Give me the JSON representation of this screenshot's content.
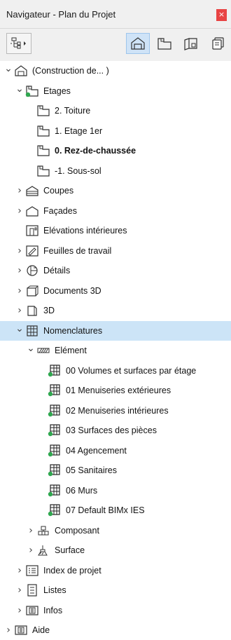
{
  "window": {
    "title": "Navigateur - Plan du Projet",
    "close_symbol": "×"
  },
  "toolbar": {
    "buttons": [
      {
        "icon": "navigator-menu-icon"
      },
      {
        "icon": "project-map-icon",
        "active": true
      },
      {
        "icon": "view-map-icon"
      },
      {
        "icon": "layout-book-icon"
      },
      {
        "icon": "publisher-sets-icon"
      }
    ]
  },
  "tree": [
    {
      "label": "(Construction de... )",
      "depth": 0,
      "expanded": true,
      "icon": "project-icon"
    },
    {
      "label": "Etages",
      "depth": 1,
      "expanded": true,
      "icon": "stories-icon",
      "dot": true
    },
    {
      "label": "2. Toiture",
      "depth": 2,
      "icon": "story-icon"
    },
    {
      "label": "1. Etage 1er",
      "depth": 2,
      "icon": "story-icon"
    },
    {
      "label": "0. Rez-de-chaussée",
      "depth": 2,
      "icon": "story-icon",
      "bold": true
    },
    {
      "label": "-1. Sous-sol",
      "depth": 2,
      "icon": "story-icon"
    },
    {
      "label": "Coupes",
      "depth": 1,
      "expanded": false,
      "icon": "sections-icon"
    },
    {
      "label": "Façades",
      "depth": 1,
      "expanded": false,
      "icon": "elevations-icon"
    },
    {
      "label": "Elévations intérieures",
      "depth": 1,
      "icon": "interior-elevations-icon"
    },
    {
      "label": "Feuilles de travail",
      "depth": 1,
      "expanded": false,
      "icon": "worksheets-icon"
    },
    {
      "label": "Détails",
      "depth": 1,
      "expanded": false,
      "icon": "details-icon"
    },
    {
      "label": "Documents 3D",
      "depth": 1,
      "expanded": false,
      "icon": "documents-3d-icon"
    },
    {
      "label": "3D",
      "depth": 1,
      "expanded": false,
      "icon": "3d-icon"
    },
    {
      "label": "Nomenclatures",
      "depth": 1,
      "expanded": true,
      "icon": "schedules-icon",
      "selected": true
    },
    {
      "label": "Elément",
      "depth": 2,
      "expanded": true,
      "icon": "element-hatch-icon"
    },
    {
      "label": "00 Volumes et surfaces par étage",
      "depth": 3,
      "icon": "schedule-icon",
      "dot": true
    },
    {
      "label": "01 Menuiseries extérieures",
      "depth": 3,
      "icon": "schedule-icon",
      "dot": true
    },
    {
      "label": "02 Menuiseries intérieures",
      "depth": 3,
      "icon": "schedule-icon",
      "dot": true
    },
    {
      "label": "03 Surfaces des pièces",
      "depth": 3,
      "icon": "schedule-icon",
      "dot": true
    },
    {
      "label": "04 Agencement",
      "depth": 3,
      "icon": "schedule-icon",
      "dot": true
    },
    {
      "label": "05 Sanitaires",
      "depth": 3,
      "icon": "schedule-icon",
      "dot": true
    },
    {
      "label": "06 Murs",
      "depth": 3,
      "icon": "schedule-icon",
      "dot": true
    },
    {
      "label": "07 Default BIMx IES",
      "depth": 3,
      "icon": "schedule-icon",
      "dot": true
    },
    {
      "label": "Composant",
      "depth": 2,
      "expanded": false,
      "icon": "component-icon"
    },
    {
      "label": "Surface",
      "depth": 2,
      "expanded": false,
      "icon": "surface-icon"
    },
    {
      "label": "Index de projet",
      "depth": 1,
      "expanded": false,
      "icon": "project-index-icon"
    },
    {
      "label": "Listes",
      "depth": 1,
      "expanded": false,
      "icon": "lists-icon"
    },
    {
      "label": "Infos",
      "depth": 1,
      "expanded": false,
      "icon": "info-icon"
    },
    {
      "label": "Aide",
      "depth": 0,
      "expanded": false,
      "icon": "help-icon"
    }
  ]
}
